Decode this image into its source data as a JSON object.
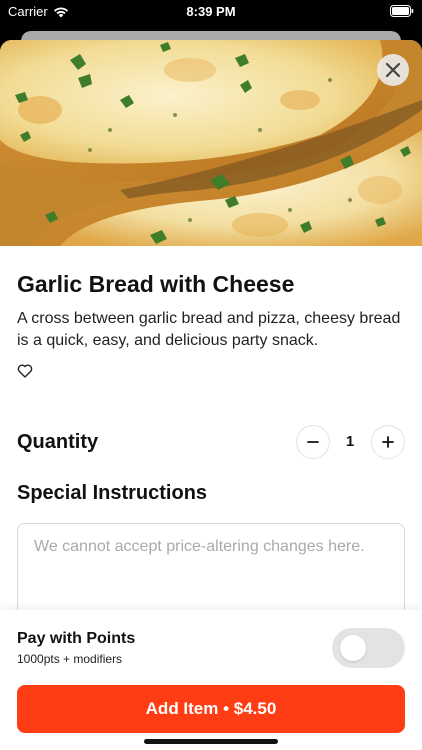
{
  "status_bar": {
    "carrier": "Carrier",
    "time": "8:39 PM"
  },
  "item": {
    "title": "Garlic Bread with Cheese",
    "description": "A cross between garlic bread and pizza, cheesy bread is a quick, easy, and delicious party snack.",
    "image_icon": "garlic-bread-photo"
  },
  "quantity": {
    "label": "Quantity",
    "value": "1",
    "minus_symbol": "−",
    "plus_symbol": "+"
  },
  "special_instructions": {
    "label": "Special Instructions",
    "placeholder": "We cannot accept price-altering changes here.",
    "value": ""
  },
  "points": {
    "title": "Pay with Points",
    "subtitle": "1000pts + modifiers",
    "enabled": false
  },
  "add_button": {
    "label": "Add Item • $4.50"
  },
  "colors": {
    "accent": "#ff3d14",
    "toggle_off": "#e3e3e3"
  },
  "icons": {
    "close": "close-icon",
    "favorite": "heart-outline-icon",
    "wifi": "wifi-icon",
    "battery": "battery-icon"
  }
}
